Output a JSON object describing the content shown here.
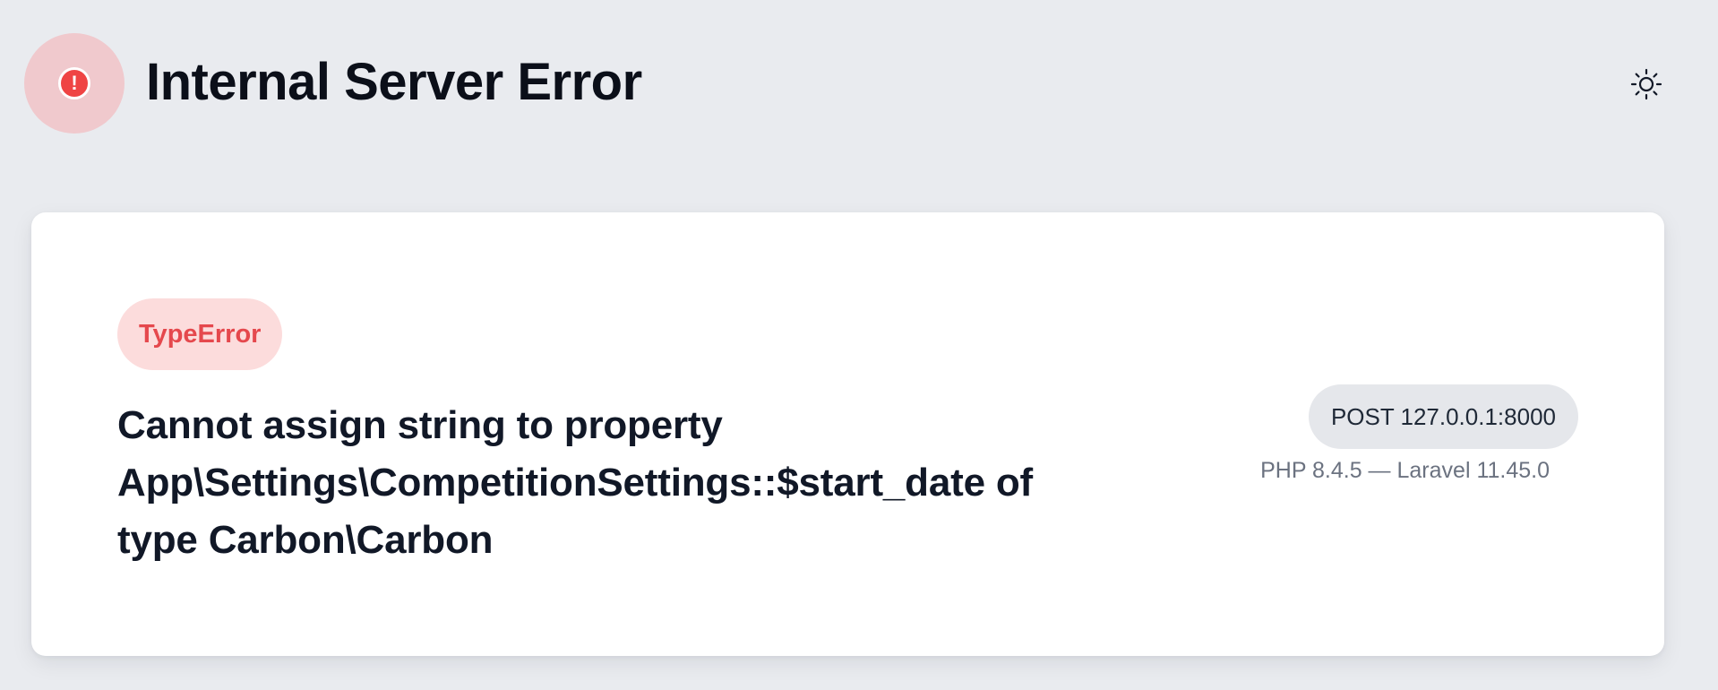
{
  "header": {
    "title": "Internal Server Error",
    "status_icon": "exclamation-icon",
    "status_color": "#ef4444",
    "theme_toggle_icon": "sun-icon"
  },
  "error": {
    "type": "TypeError",
    "message": "Cannot assign string to property App\\Settings\\CompetitionSettings::$start_date of type Carbon\\Carbon",
    "type_badge_color": "#e5484d"
  },
  "request": {
    "label": "POST 127.0.0.1:8000"
  },
  "environment": {
    "versions": "PHP 8.4.5 — Laravel 11.45.0"
  }
}
